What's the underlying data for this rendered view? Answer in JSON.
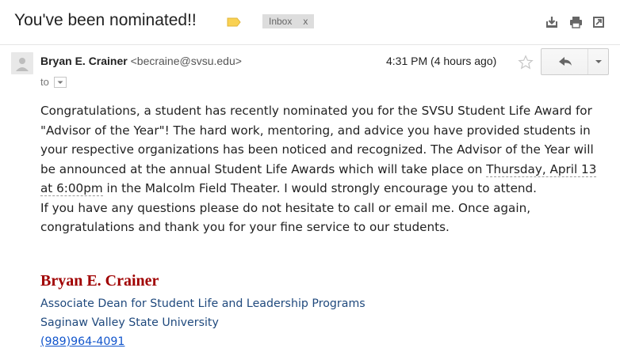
{
  "header": {
    "subject": "You've been nominated!!",
    "label": "Inbox",
    "label_remove": "x"
  },
  "toolbar_icons": [
    "download-icon",
    "print-icon",
    "new-window-icon"
  ],
  "message": {
    "sender_name": "Bryan E. Crainer",
    "sender_email": "<becraine@svsu.edu>",
    "to_label": "to",
    "timestamp": "4:31 PM (4 hours ago)",
    "body": {
      "p1_before": "Congratulations, a student has recently nominated you for the SVSU Student Life Award for \"Advisor of the Year\"! The hard work, mentoring, and advice you have provided students in your respective organizations has been noticed and recognized. The Advisor of the Year will be announced at the annual Student Life Awards which will take place on ",
      "p1_date": "Thursday, April 13 at 6:00pm",
      "p1_after": " in the Malcolm Field Theater. I would strongly encourage you to attend.",
      "p2": "If you have any questions please do not hesitate to call or email me. Once again, congratulations and thank you for your fine service to our students."
    },
    "signature": {
      "name": "Bryan E. Crainer",
      "title": "Associate Dean for Student Life and Leadership Programs",
      "org": "Saginaw Valley State University",
      "phone": "(989)964-4091"
    }
  },
  "colors": {
    "signature_name": "#a00000",
    "signature_text": "#1f497d",
    "link": "#1155cc",
    "important_tag": "#f9d152"
  }
}
